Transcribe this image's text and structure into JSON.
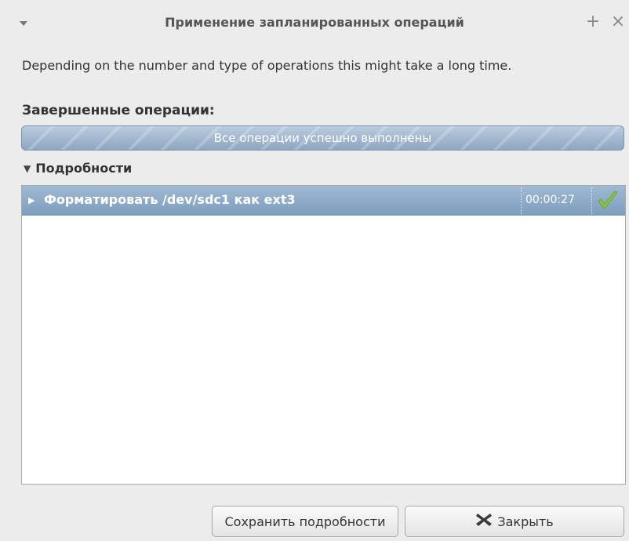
{
  "window": {
    "title": "Применение запланированных операций",
    "menu_icon": "chevron-down-icon",
    "maximize_icon": "plus-icon",
    "close_icon": "close-icon",
    "maximize_glyph": "+",
    "close_glyph": "×"
  },
  "description": "Depending on the number and type of operations this might take a long time.",
  "completed": {
    "label": "Завершенные операции:",
    "progress_text": "Все операции успешно выполнены",
    "progress_fraction": 1.0
  },
  "details": {
    "label": "Подробности",
    "expanded": true,
    "rows": [
      {
        "label": "Форматировать /dev/sdc1 как ext3",
        "time": "00:00:27",
        "status_icon": "checkmark-icon",
        "status_color": "#8ac63e"
      }
    ]
  },
  "buttons": {
    "save_label": "Сохранить подробности",
    "close_label": "Закрыть",
    "close_icon": "x-icon"
  },
  "colors": {
    "selection": "#8ea8c4",
    "progress": "#9fb6cf"
  }
}
